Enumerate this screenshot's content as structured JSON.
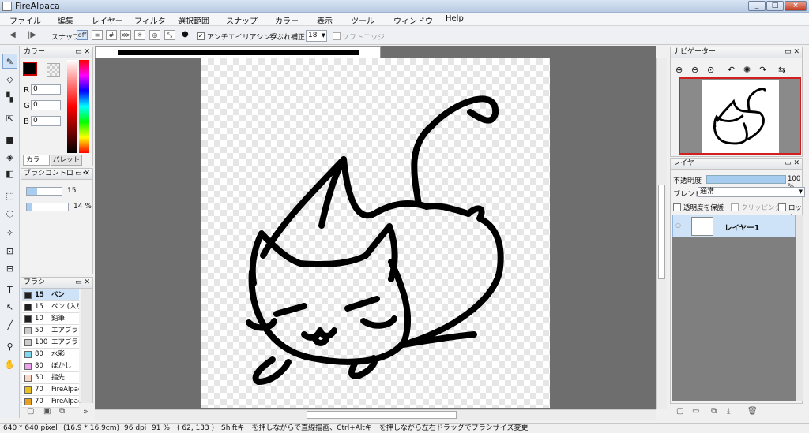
{
  "window": {
    "title": "FireAlpaca",
    "buttons": [
      "_",
      "□",
      "×"
    ]
  },
  "menu": [
    "ファイル",
    "編集",
    "レイヤー",
    "フィルタ",
    "選択範囲",
    "スナップ",
    "カラー",
    "表示",
    "ツール",
    "ウィンドウ",
    "Help"
  ],
  "toolbar": {
    "snap_label": "スナップ",
    "snap_off": "off",
    "antialias_label": "アンチエイリアシング",
    "antialias_checked": true,
    "stabilizer_label": "手ぶれ補正",
    "stabilizer_value": "18",
    "soft_edge_label": "ソフトエッジ",
    "soft_edge_checked": false
  },
  "color_panel": {
    "title": "カラー",
    "r_label": "R",
    "r_value": "0",
    "g_label": "G",
    "g_value": "0",
    "b_label": "B",
    "b_value": "0",
    "tab_color": "カラー",
    "tab_palette": "パレット",
    "primary": "#000000",
    "secondary": "#ffffff",
    "accent": "#cc0000"
  },
  "brush_control": {
    "title": "ブラシコントロ・・",
    "size": "15",
    "opacity": "14 %"
  },
  "brush_panel": {
    "title": "ブラシ",
    "items": [
      {
        "size": "15",
        "name": "ペン",
        "color": "#202020"
      },
      {
        "size": "15",
        "name": "ペン (入り",
        "color": "#202020"
      },
      {
        "size": "10",
        "name": "鉛筆",
        "color": "#202020"
      },
      {
        "size": "50",
        "name": "エアブラシ",
        "color": "#cccccc"
      },
      {
        "size": "100",
        "name": "エアブラシ",
        "color": "#cccccc"
      },
      {
        "size": "80",
        "name": "水彩",
        "color": "#80d8f0"
      },
      {
        "size": "80",
        "name": "ぼかし",
        "color": "#f0a0f0"
      },
      {
        "size": "50",
        "name": "指先",
        "color": "#f8d8c8"
      },
      {
        "size": "70",
        "name": "FireAlpac",
        "color": "#e8c020"
      },
      {
        "size": "70",
        "name": "FireAlpac",
        "color": "#e8a020"
      }
    ]
  },
  "navigator": {
    "title": "ナビゲーター"
  },
  "layer_panel": {
    "title": "レイヤー",
    "opacity_label": "不透明度",
    "opacity_value": "100 %",
    "opacity_fraction": 1.0,
    "blend_label": "ブレンド",
    "blend_value": "通常",
    "protect_label": "透明度を保護",
    "clipping_label": "クリッピング",
    "lock_label": "ロック",
    "layers": [
      {
        "name": "レイヤー1"
      }
    ]
  },
  "status": {
    "size": "640 * 640 pixel",
    "physical": "(16.9 * 16.9cm)",
    "dpi": "96 dpi",
    "zoom": "91 %",
    "coords": "( 62, 133 )",
    "hint": "Shiftキーを押しながらで直線描画、Ctrl+Altキーを押しながら左右ドラッグでブラシサイズ変更"
  }
}
